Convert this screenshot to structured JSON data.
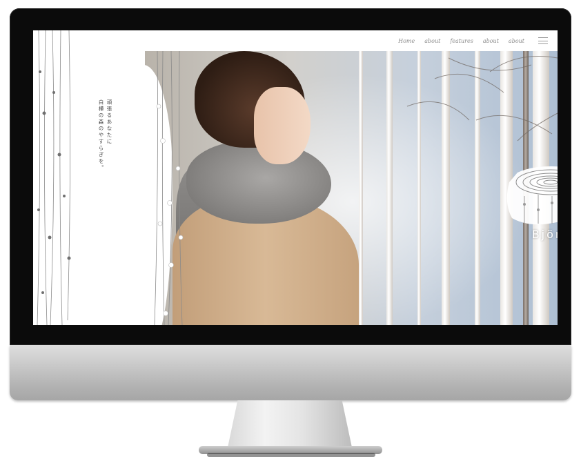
{
  "nav": {
    "items": [
      "Home",
      "about",
      "features",
      "about",
      "about"
    ],
    "menu_icon": "hamburger-menu-icon"
  },
  "tagline": {
    "lines": [
      "頑張るあなたに",
      "白樺の森のやすらぎを。"
    ]
  },
  "brand": {
    "name": "Björka"
  },
  "colors": {
    "bezel": "#0b0b0b",
    "nav_text": "#8a8a8a",
    "tagline_text": "#4a4a4a",
    "logo": "#ffffff"
  }
}
